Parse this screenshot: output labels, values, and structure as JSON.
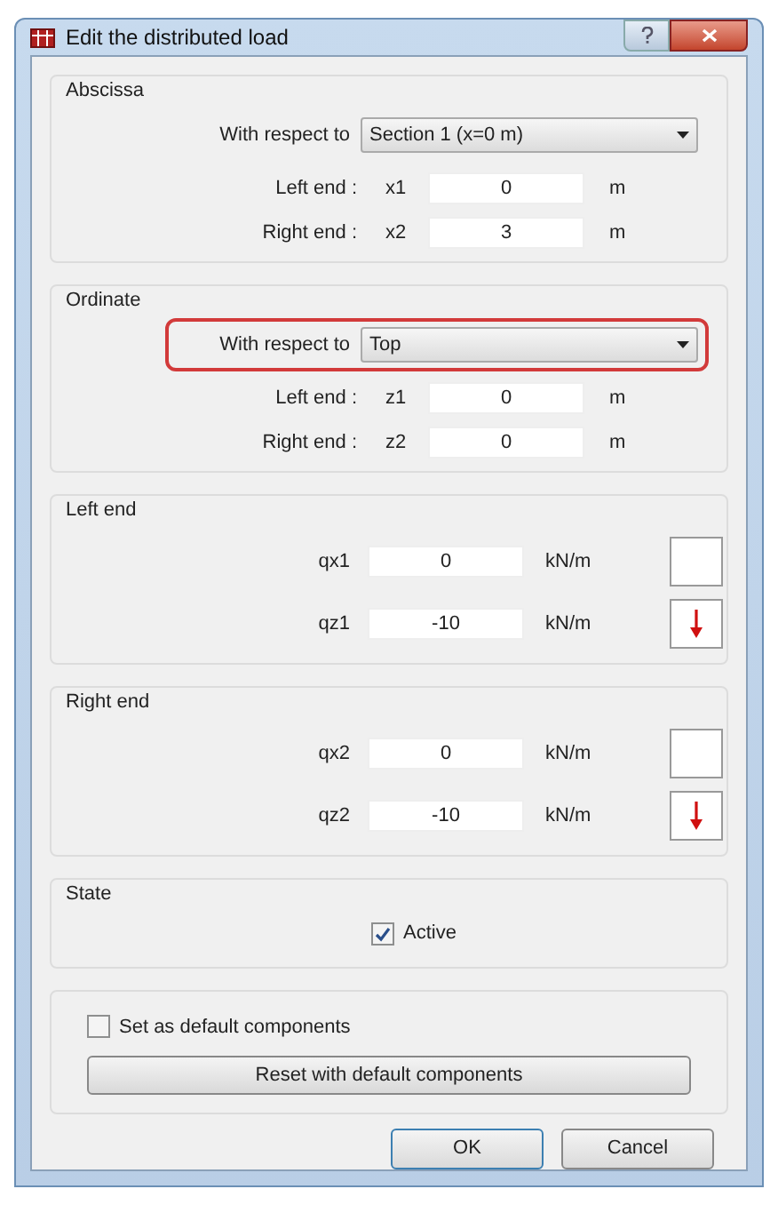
{
  "window": {
    "title": "Edit the distributed load"
  },
  "abscissa": {
    "title": "Abscissa",
    "reference_label": "With respect to",
    "reference": {
      "value": "Section 1 (x=0 m)",
      "highlighted": false
    },
    "rows": [
      {
        "label": "Left end :",
        "symbol": "x1",
        "value": "0",
        "unit": "m"
      },
      {
        "label": "Right end :",
        "symbol": "x2",
        "value": "3",
        "unit": "m"
      }
    ]
  },
  "ordinate": {
    "title": "Ordinate",
    "reference_label": "With respect to",
    "reference": {
      "value": "Top",
      "highlighted": true
    },
    "rows": [
      {
        "label": "Left end :",
        "symbol": "z1",
        "value": "0",
        "unit": "m"
      },
      {
        "label": "Right end :",
        "symbol": "z2",
        "value": "0",
        "unit": "m"
      }
    ]
  },
  "load_groups": [
    {
      "title": "Left end",
      "rows": [
        {
          "symbol": "qx1",
          "value": "0",
          "unit": "kN/m",
          "arrow_shown": false
        },
        {
          "symbol": "qz1",
          "value": "-10",
          "unit": "kN/m",
          "arrow_shown": true
        }
      ]
    },
    {
      "title": "Right end",
      "rows": [
        {
          "symbol": "qx2",
          "value": "0",
          "unit": "kN/m",
          "arrow_shown": false
        },
        {
          "symbol": "qz2",
          "value": "-10",
          "unit": "kN/m",
          "arrow_shown": true
        }
      ]
    }
  ],
  "state": {
    "title": "State",
    "active": {
      "label": "Active",
      "checked": true
    }
  },
  "defaults": {
    "set_default": {
      "label": "Set as default components",
      "checked": false
    },
    "reset_button": "Reset with default components"
  },
  "buttons": [
    {
      "label": "OK",
      "default": true
    },
    {
      "label": "Cancel",
      "default": false
    }
  ]
}
